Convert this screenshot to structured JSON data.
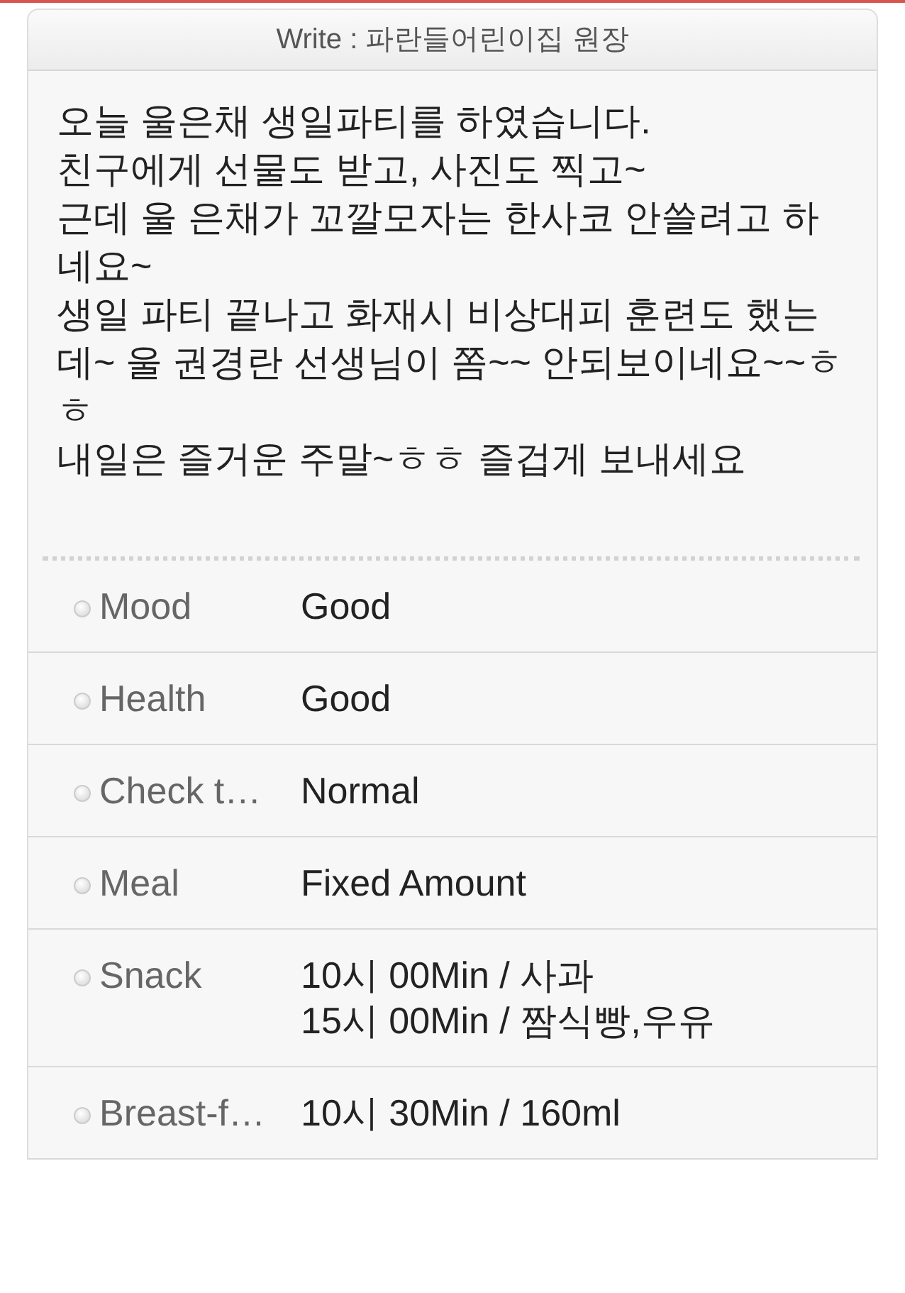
{
  "header": {
    "title": "Write : 파란들어린이집 원장"
  },
  "message": [
    "오늘 울은채 생일파티를 하였습니다.",
    "친구에게 선물도 받고, 사진도 찍고~",
    "근데 울 은채가 꼬깔모자는 한사코 안쓸려고 하네요~",
    "생일 파티 끝나고 화재시 비상대피 훈련도 했는데~  울 권경란 선생님이  쫌~~  안되보이네요~~ㅎㅎ",
    "내일은 즐거운 주말~ㅎㅎ 즐겁게 보내세요"
  ],
  "details": [
    {
      "label": "Mood",
      "value": [
        "Good"
      ]
    },
    {
      "label": "Health",
      "value": [
        "Good"
      ]
    },
    {
      "label": "Check t…",
      "value": [
        "Normal"
      ]
    },
    {
      "label": "Meal",
      "value": [
        "Fixed Amount"
      ]
    },
    {
      "label": "Snack",
      "value": [
        "10시 00Min / 사과",
        "15시 00Min / 짬식빵,우유"
      ]
    },
    {
      "label": "Breast-f…",
      "value": [
        "10시 30Min / 160ml"
      ]
    }
  ]
}
